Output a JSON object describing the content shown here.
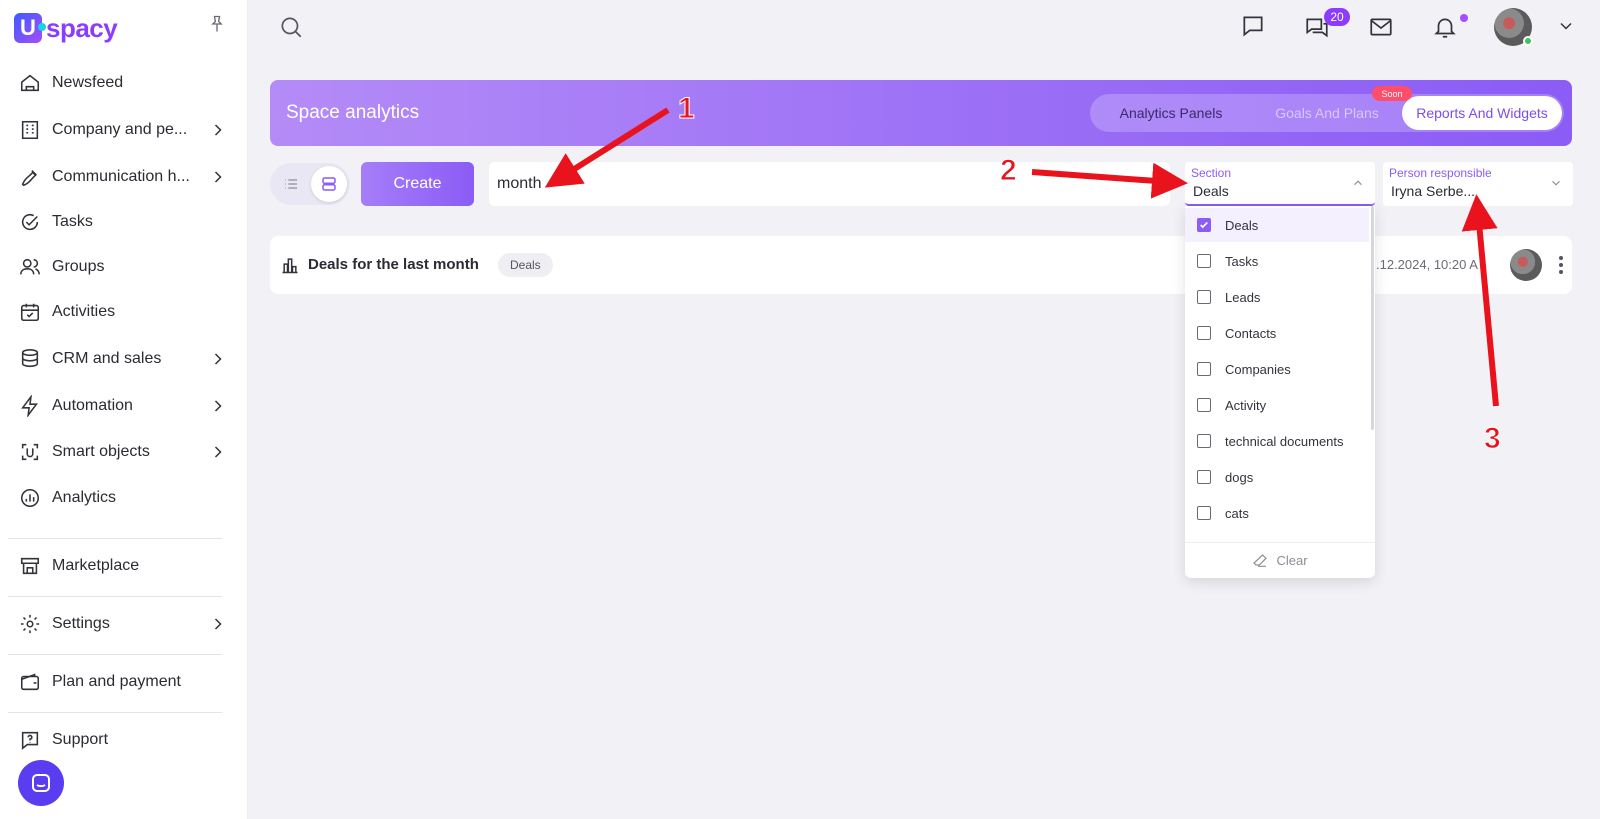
{
  "app": {
    "logo_letter": "U",
    "logo_text": "spacy"
  },
  "sidebar": {
    "items": [
      {
        "label": "Newsfeed"
      },
      {
        "label": "Company and pe..."
      },
      {
        "label": "Communication h..."
      },
      {
        "label": "Tasks"
      },
      {
        "label": "Groups"
      },
      {
        "label": "Activities"
      },
      {
        "label": "CRM and sales"
      },
      {
        "label": "Automation"
      },
      {
        "label": "Smart objects"
      },
      {
        "label": "Analytics"
      },
      {
        "label": "Marketplace"
      },
      {
        "label": "Settings"
      },
      {
        "label": "Plan and payment"
      },
      {
        "label": "Support"
      }
    ]
  },
  "topbar": {
    "messages_badge": "20"
  },
  "banner": {
    "title": "Space analytics",
    "tabs": [
      {
        "label": "Analytics Panels"
      },
      {
        "label": "Goals And Plans"
      },
      {
        "label": "Reports And Widgets"
      }
    ],
    "soon_badge": "Soon"
  },
  "toolbar": {
    "create_label": "Create",
    "search_value": "month",
    "section": {
      "label": "Section",
      "value": "Deals"
    },
    "person": {
      "label": "Person responsible",
      "value": "Iryna Serbe..."
    }
  },
  "section_dropdown": {
    "options": [
      {
        "label": "Deals",
        "checked": true
      },
      {
        "label": "Tasks",
        "checked": false
      },
      {
        "label": "Leads",
        "checked": false
      },
      {
        "label": "Contacts",
        "checked": false
      },
      {
        "label": "Companies",
        "checked": false
      },
      {
        "label": "Activity",
        "checked": false
      },
      {
        "label": "technical documents",
        "checked": false
      },
      {
        "label": "dogs",
        "checked": false
      },
      {
        "label": "cats",
        "checked": false
      }
    ],
    "clear_label": "Clear"
  },
  "results": [
    {
      "title": "Deals for the last month",
      "tag": "Deals",
      "date": ".12.2024, 10:20 A"
    }
  ],
  "annotations": [
    "1",
    "2",
    "3"
  ],
  "colors": {
    "accent": "#8b5cf6",
    "annotation": "#e8131c"
  }
}
